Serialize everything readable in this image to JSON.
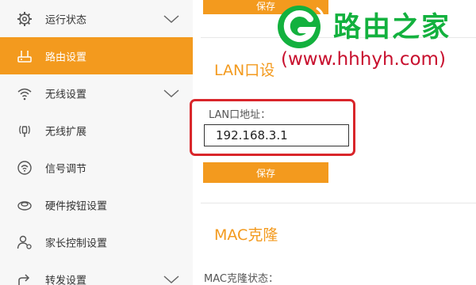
{
  "sidebar": {
    "items": [
      {
        "label": "运行状态",
        "icon": "gear-icon",
        "has_chevron": true
      },
      {
        "label": "路由设置",
        "icon": "router-icon",
        "active": true
      },
      {
        "label": "无线设置",
        "icon": "wifi-icon",
        "has_chevron": true
      },
      {
        "label": "无线扩展",
        "icon": "wireless-extend-icon"
      },
      {
        "label": "信号调节",
        "icon": "signal-icon"
      },
      {
        "label": "硬件按钮设置",
        "icon": "hardware-button-icon"
      },
      {
        "label": "家长控制设置",
        "icon": "parental-control-icon"
      },
      {
        "label": "转发设置",
        "icon": "forward-icon",
        "has_chevron": true
      }
    ]
  },
  "main": {
    "save_top_label": "保存",
    "lan_section_title": "LAN口设",
    "lan_address_label": "LAN口地址：",
    "lan_address_value": "192.168.3.1",
    "save_label": "保存",
    "mac_section_title": "MAC克隆",
    "mac_status_label": "MAC克隆状态："
  },
  "watermark": {
    "title": "路由之家",
    "url": "(www.hhhyh.com)"
  },
  "colors": {
    "accent": "#f39a1e",
    "highlight_frame": "#d9262b",
    "watermark_green": "#13b13e",
    "watermark_red": "#c8102e",
    "sidebar_bg": "#f7f7f7"
  }
}
